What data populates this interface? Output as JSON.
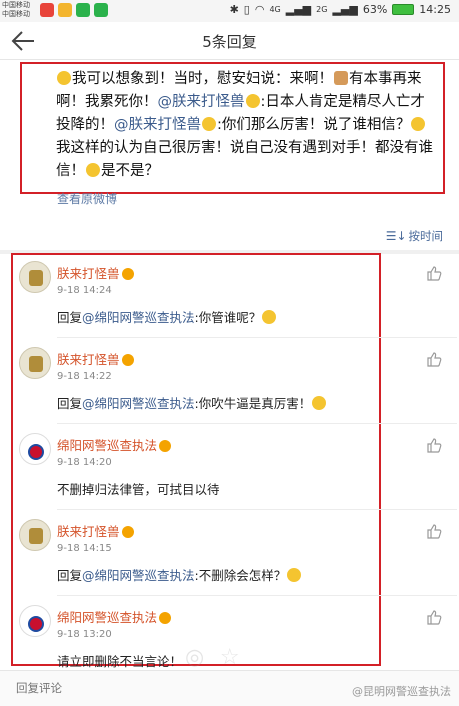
{
  "status_bar": {
    "carrier_1": "中国移动",
    "carrier_2": "中国移动",
    "signal_1": "4G",
    "signal_2": "2G",
    "battery": "63%",
    "time": "14:25"
  },
  "header": {
    "title": "5条回复"
  },
  "post": {
    "segments": [
      {
        "t": "我可以想象到！当时，慰安妇说：来啊！"
      },
      {
        "t": "有本事再来啊！我累死你！"
      },
      {
        "t": "@朕来打怪兽",
        "mention": true
      },
      {
        "t": ":日本人肯定是精尽人亡才投降的！"
      },
      {
        "t": "@朕来打怪兽",
        "mention": true
      },
      {
        "t": ":你们那么厉害！说了谁相信？"
      },
      {
        "t": "我这样的认为自己很厉害！说自己没有遇到对手！都没有谁信！"
      },
      {
        "t": "是不是？"
      }
    ],
    "view_original": "查看原微博"
  },
  "sort_label": "按时间",
  "comments": [
    {
      "name": "朕来打怪兽",
      "time": "9-18 14:24",
      "prefix": "回复",
      "mention": "@绵阳网警巡查执法",
      "text": ":你管谁呢？",
      "avatar": "cartoon"
    },
    {
      "name": "朕来打怪兽",
      "time": "9-18 14:22",
      "prefix": "回复",
      "mention": "@绵阳网警巡查执法",
      "text": ":你吹牛逼是真厉害！",
      "avatar": "cartoon"
    },
    {
      "name": "绵阳网警巡查执法",
      "time": "9-18 14:20",
      "prefix": "",
      "mention": "",
      "text": "不删掉归法律管，可拭目以待",
      "avatar": "police"
    },
    {
      "name": "朕来打怪兽",
      "time": "9-18 14:15",
      "prefix": "回复",
      "mention": "@绵阳网警巡查执法",
      "text": ":不删除会怎样？",
      "avatar": "cartoon"
    },
    {
      "name": "绵阳网警巡查执法",
      "time": "9-18 13:20",
      "prefix": "",
      "mention": "",
      "text": "请立即删除不当言论！",
      "avatar": "police"
    }
  ],
  "bottom": {
    "reply_placeholder": "回复评论",
    "watermark": "@昆明网警巡查执法"
  },
  "colors": {
    "highlight_border": "#d32027",
    "mention": "#3b5b8c",
    "username": "#d4532a"
  }
}
